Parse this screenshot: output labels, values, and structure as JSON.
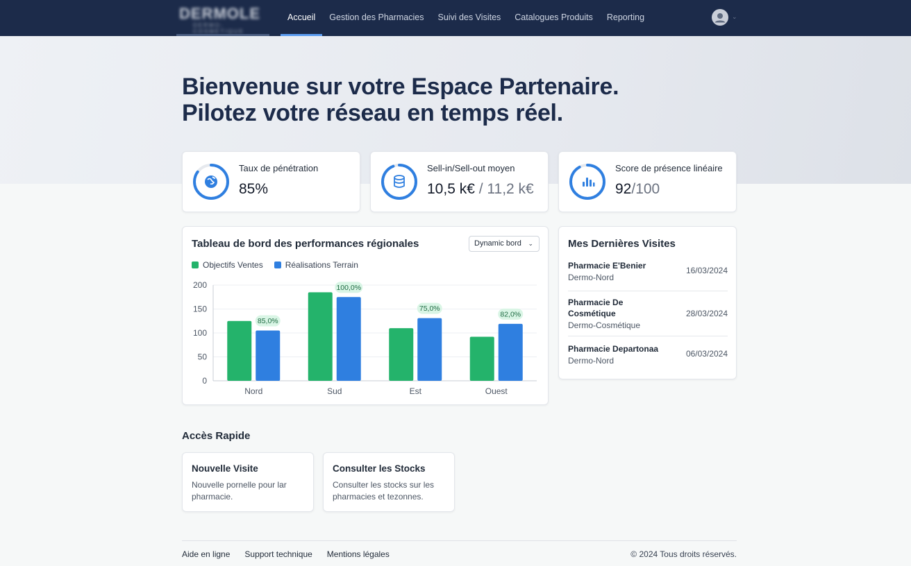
{
  "app": {
    "logo_text": "DERMOLE",
    "logo_subtext": "DERMO-COSMETIQUE"
  },
  "nav": {
    "items": [
      {
        "label": "Accueil",
        "active": true
      },
      {
        "label": "Gestion des Pharmacies",
        "active": false
      },
      {
        "label": "Suivi des Visites",
        "active": false
      },
      {
        "label": "Catalogues Produits",
        "active": false
      },
      {
        "label": "Reporting",
        "active": false
      }
    ],
    "user_icon": "user-avatar-icon"
  },
  "hero": {
    "line1": "Bienvenue sur votre Espace Partenaire.",
    "line2": "Pilotez votre réseau en temps réel."
  },
  "kpis": [
    {
      "label": "Taux de pénétration",
      "value": "85%",
      "value_muted": "",
      "icon": "globe-icon",
      "progress": 0.85
    },
    {
      "label": "Sell-in/Sell-out moyen",
      "value": "10,5 k€",
      "value_muted": " / 11,2 k€",
      "icon": "database-icon",
      "progress": 0.94
    },
    {
      "label": "Score de présence linéaire",
      "value": "92",
      "value_muted": "/100",
      "icon": "bar-chart-icon",
      "progress": 0.92
    }
  ],
  "colors": {
    "primary_navy": "#1c2b4a",
    "accent_blue": "#2f7fe0",
    "series_green": "#24b36b",
    "series_blue": "#2f7fe0",
    "badge_bg": "#d9f5e5",
    "badge_text": "#1f6b43"
  },
  "chart": {
    "title": "Tableau de bord des performances régionales",
    "dropdown_value": "Dynamic bord"
  },
  "chart_data": {
    "type": "bar",
    "categories": [
      "Nord",
      "Sud",
      "Est",
      "Ouest"
    ],
    "series": [
      {
        "name": "Objectifs Ventes",
        "values": [
          125,
          185,
          110,
          92
        ]
      },
      {
        "name": "Réalisations Terrain",
        "values": [
          105,
          175,
          131,
          119
        ]
      }
    ],
    "annotations": [
      "85,0%",
      "100,0%",
      "75,0%",
      "82,0%"
    ],
    "ylim": [
      0,
      200
    ],
    "yticks": [
      "200",
      "150",
      "100",
      "50",
      "0"
    ],
    "grid": true,
    "legend": "top-left"
  },
  "visits": {
    "title": "Mes Dernières Visites",
    "items": [
      {
        "name": "Pharmacie E'Benier",
        "region": "Dermo-Nord",
        "date": "16/03/2024"
      },
      {
        "name": "Pharmacie De Cosmétique",
        "region": "Dermo-Cosmétique",
        "date": "28/03/2024"
      },
      {
        "name": "Pharmacie Departonaa",
        "region": "Dermo-Nord",
        "date": "06/03/2024"
      }
    ]
  },
  "quick_access": {
    "title": "Accès Rapide",
    "items": [
      {
        "title": "Nouvelle Visite",
        "desc": "Nouvelle pornelle pour lar pharmacie."
      },
      {
        "title": "Consulter les Stocks",
        "desc": "Consulter les stocks sur les pharmacies et tezonnes."
      }
    ]
  },
  "footer": {
    "links": [
      "Aide en ligne",
      "Support technique",
      "Mentions légales"
    ],
    "copyright": "© 2024 Tous droits réservés."
  }
}
